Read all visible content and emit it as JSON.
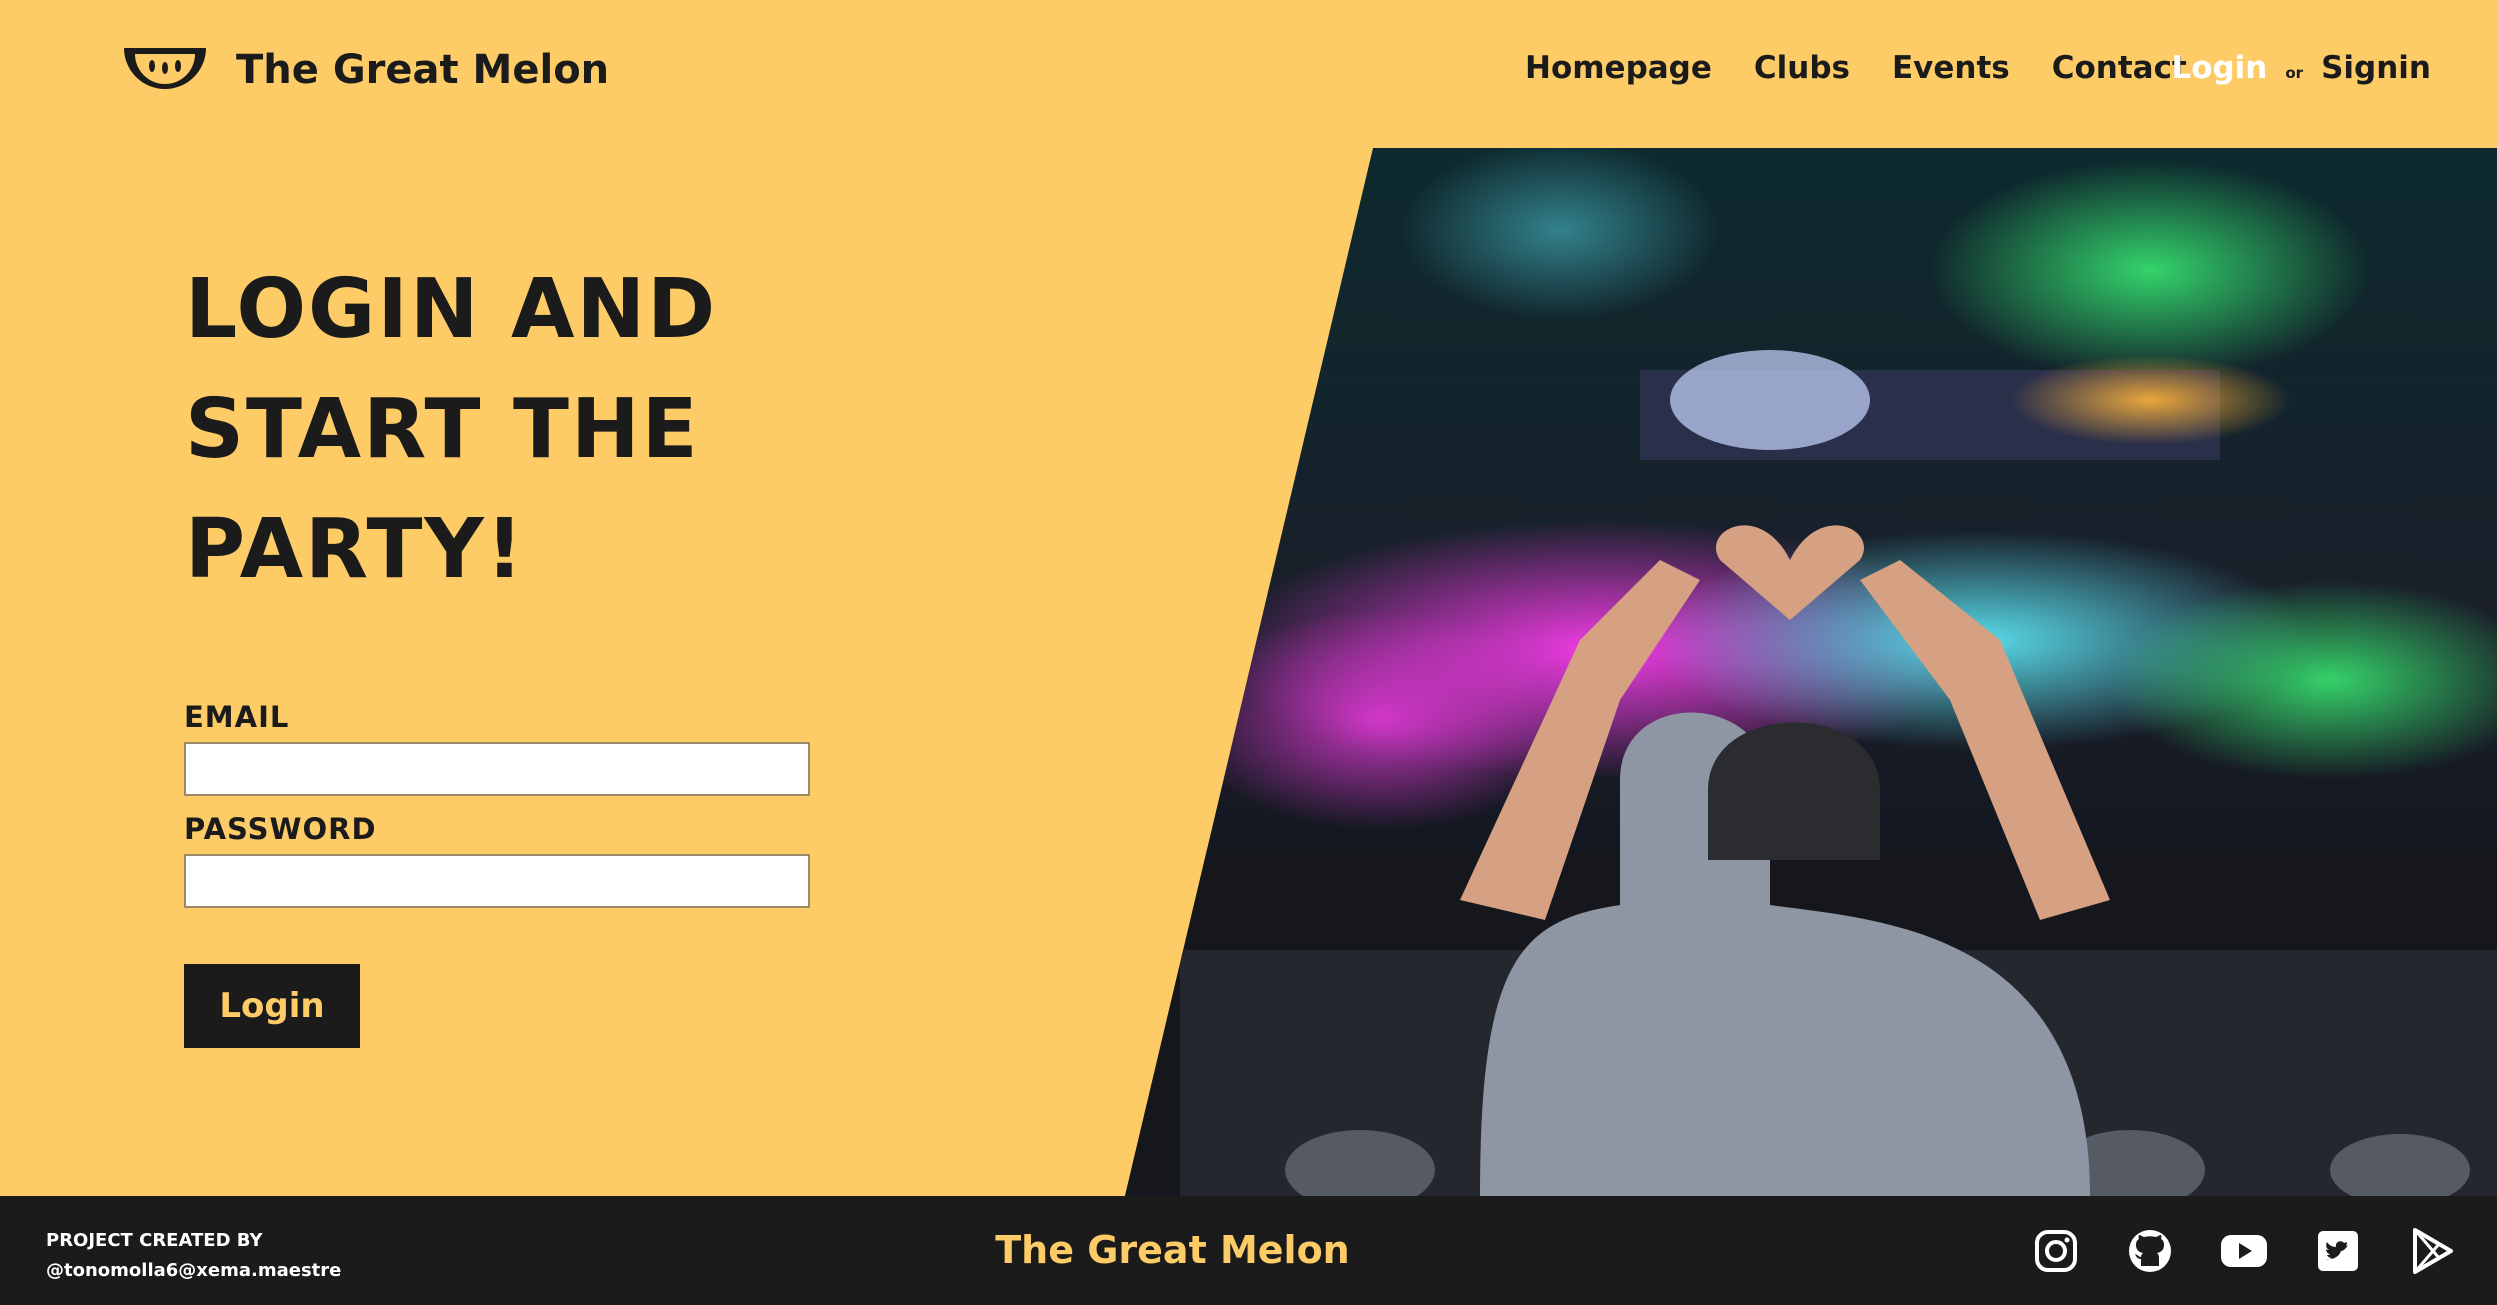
{
  "brand": {
    "name": "The Great Melon"
  },
  "nav": {
    "items": [
      "Homepage",
      "Clubs",
      "Events",
      "Contact"
    ]
  },
  "auth": {
    "login": "Login",
    "or": "or",
    "signin": "Signin"
  },
  "hero": {
    "title": "LOGIN AND START THE PARTY!",
    "image_alt": "DJ making a heart with hands over a crowd"
  },
  "form": {
    "email_label": "EMAIL",
    "email_value": "",
    "password_label": "PASSWORD",
    "password_value": "",
    "submit_label": "Login"
  },
  "footer": {
    "credit_line1": "PROJECT CREATED BY",
    "credit_line2": "@tonomolla6@xema.maestre",
    "brand": "The Great Melon",
    "social_icons": [
      "instagram-icon",
      "github-icon",
      "youtube-icon",
      "twitter-icon",
      "google-play-icon"
    ]
  },
  "colors": {
    "background": "#fecc67",
    "dark": "#1b1b1b",
    "accent_text": "#fecc67"
  }
}
